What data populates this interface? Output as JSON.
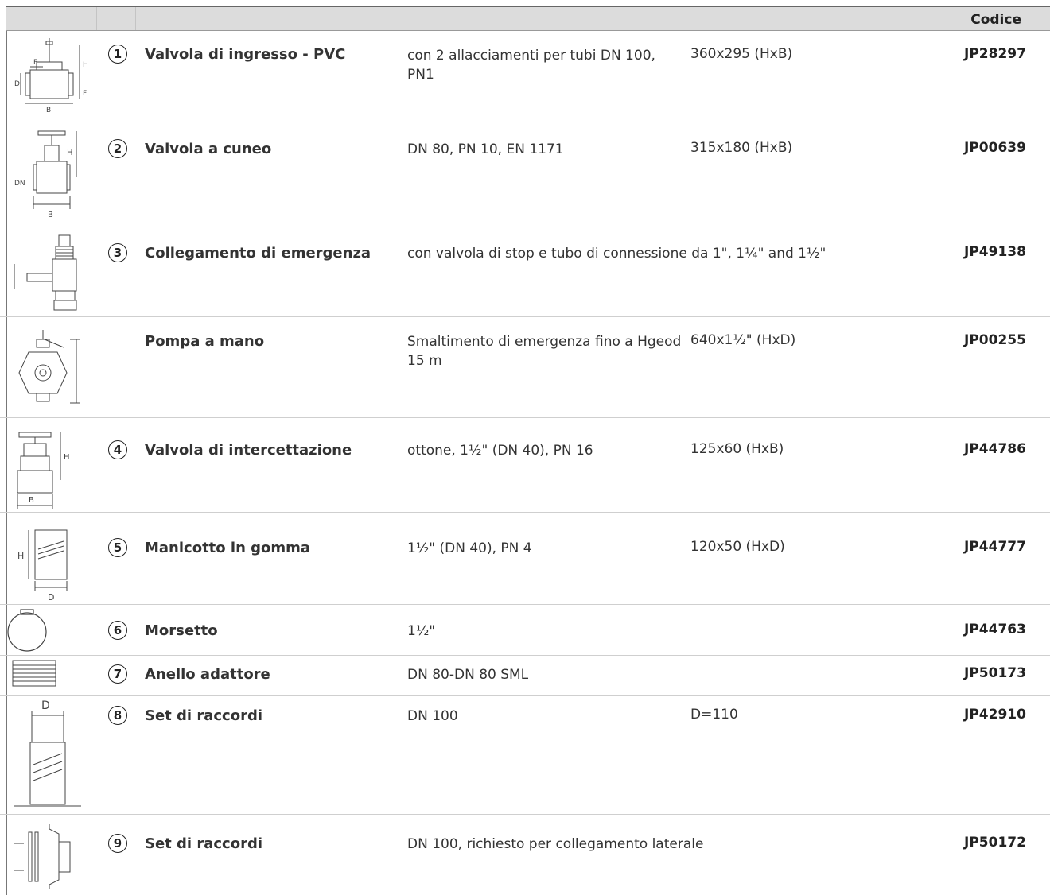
{
  "header": {
    "code_label": "Codice"
  },
  "items": [
    {
      "number": "1",
      "name": "Valvola di ingresso - PVC",
      "description": "con 2 allacciamenti per tubi DN 100, PN1",
      "dimensions": "360x295 (HxB)",
      "code": "JP28297",
      "icon": "pvc-inlet-valve-icon"
    },
    {
      "number": "2",
      "name": "Valvola a cuneo",
      "description": "DN 80, PN 10, EN 1171",
      "dimensions": "315x180 (HxB)",
      "code": "JP00639",
      "icon": "gate-valve-icon"
    },
    {
      "number": "3",
      "name": "Collegamento di emergenza",
      "description": "con valvola di stop e tubo di connessione da 1\", 1¼\" and 1½\"",
      "dimensions": "",
      "code": "JP49138",
      "icon": "emergency-connection-icon"
    },
    {
      "number": "",
      "name": "Pompa a mano",
      "description": "Smaltimento di emergenza fino a Hgeod 15 m",
      "dimensions": "640x1½\" (HxD)",
      "code": "JP00255",
      "icon": "hand-pump-icon"
    },
    {
      "number": "4",
      "name": "Valvola di intercettazione",
      "description": "ottone, 1½\" (DN 40), PN 16",
      "dimensions": "125x60 (HxB)",
      "code": "JP44786",
      "icon": "shutoff-valve-icon"
    },
    {
      "number": "5",
      "name": "Manicotto in gomma",
      "description": "1½\" (DN 40), PN 4",
      "dimensions": "120x50 (HxD)",
      "code": "JP44777",
      "icon": "rubber-sleeve-icon"
    },
    {
      "number": "6",
      "name": "Morsetto",
      "description": "1½\"",
      "dimensions": "",
      "code": "JP44763",
      "icon": "clamp-icon"
    },
    {
      "number": "7",
      "name": "Anello adattore",
      "description": "DN 80-DN 80 SML",
      "dimensions": "",
      "code": "JP50173",
      "icon": "adapter-ring-icon"
    },
    {
      "number": "8",
      "name": "Set di raccordi",
      "description": "DN 100",
      "dimensions": "D=110",
      "code": "JP42910",
      "icon": "fitting-set-icon"
    },
    {
      "number": "9",
      "name": "Set di raccordi",
      "description": "DN 100, richiesto per collegamento laterale",
      "dimensions": "",
      "code": "JP50172",
      "icon": "side-fitting-set-icon"
    }
  ],
  "drawing_labels": {
    "h": "H",
    "b": "B",
    "dn": "DN",
    "d": "D",
    "f": "F"
  }
}
